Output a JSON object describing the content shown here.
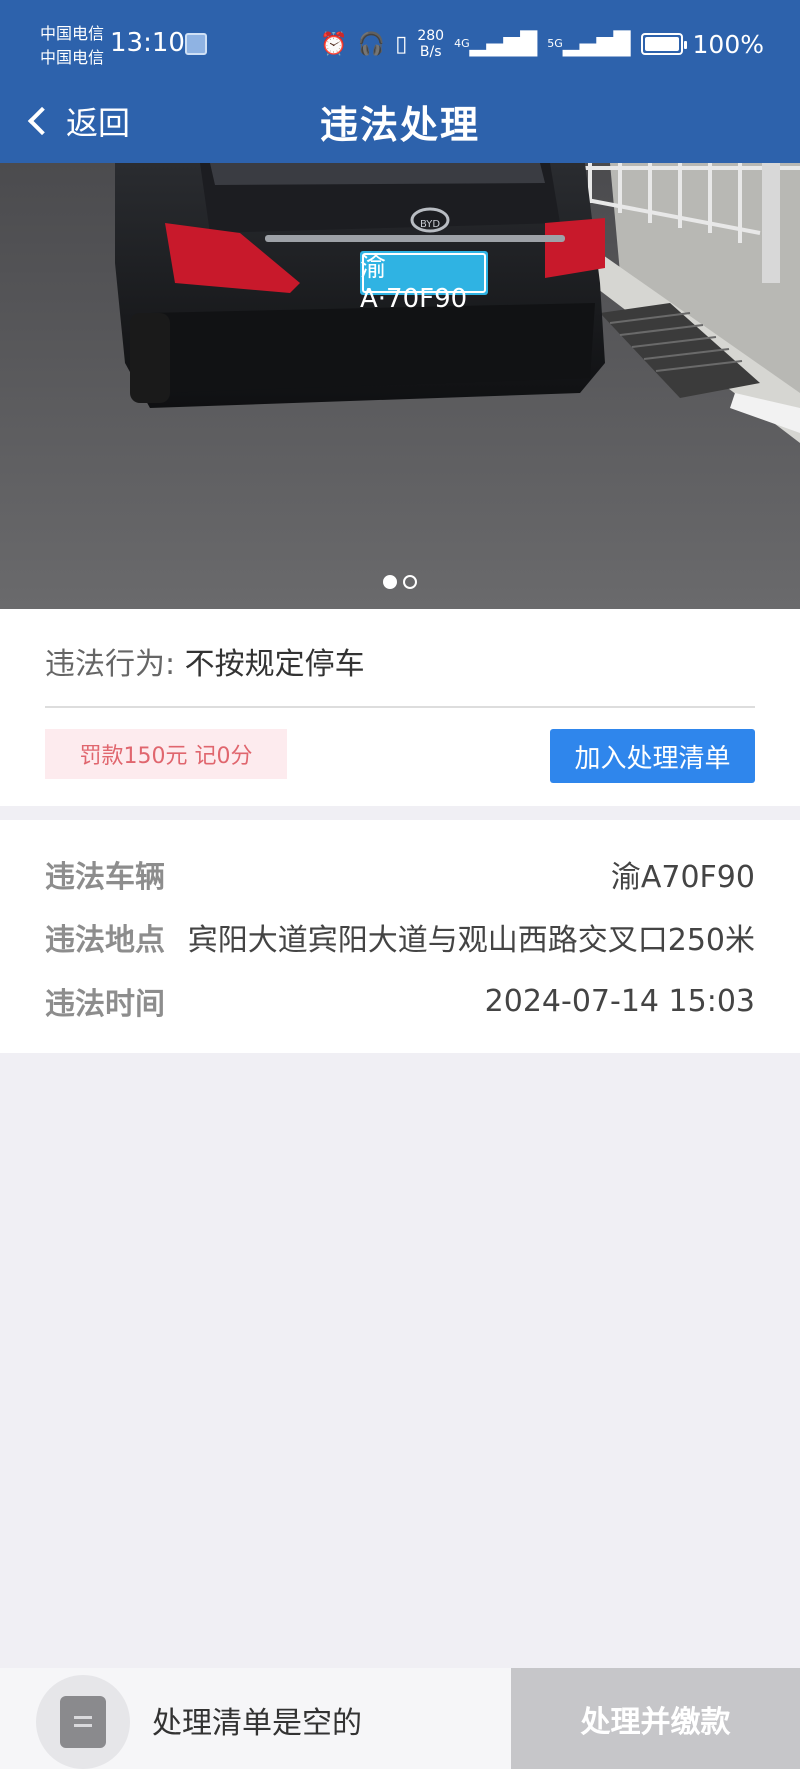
{
  "status_bar": {
    "carrier_1": "中国电信",
    "carrier_2": "中国电信",
    "time": "13:10",
    "net_speed_value": "280",
    "net_speed_unit": "B/s",
    "net_1": "4G",
    "net_2": "5G",
    "battery_percent": "100%"
  },
  "nav": {
    "back_label": "返回",
    "title": "违法处理"
  },
  "photo": {
    "plate": "渝A·70F90",
    "brand": "BYD",
    "page_count": 2,
    "active_index": 0
  },
  "violation": {
    "behavior_label": "违法行为:",
    "behavior_value": "不按规定停车",
    "fine_text": "罚款150元 记0分",
    "add_button": "加入处理清单"
  },
  "details": [
    {
      "key": "违法车辆",
      "value": "渝A70F90"
    },
    {
      "key": "违法地点",
      "value": "宾阳大道宾阳大道与观山西路交叉口250米"
    },
    {
      "key": "违法时间",
      "value": "2024-07-14 15:03"
    }
  ],
  "bottom": {
    "empty_text": "处理清单是空的",
    "pay_button": "处理并缴款"
  },
  "colors": {
    "header": "#2d62ac",
    "primary_button": "#2f86ec",
    "fine_text": "#e0666e",
    "fine_bg": "#fdebee",
    "disabled_button": "#c6c6c9"
  }
}
